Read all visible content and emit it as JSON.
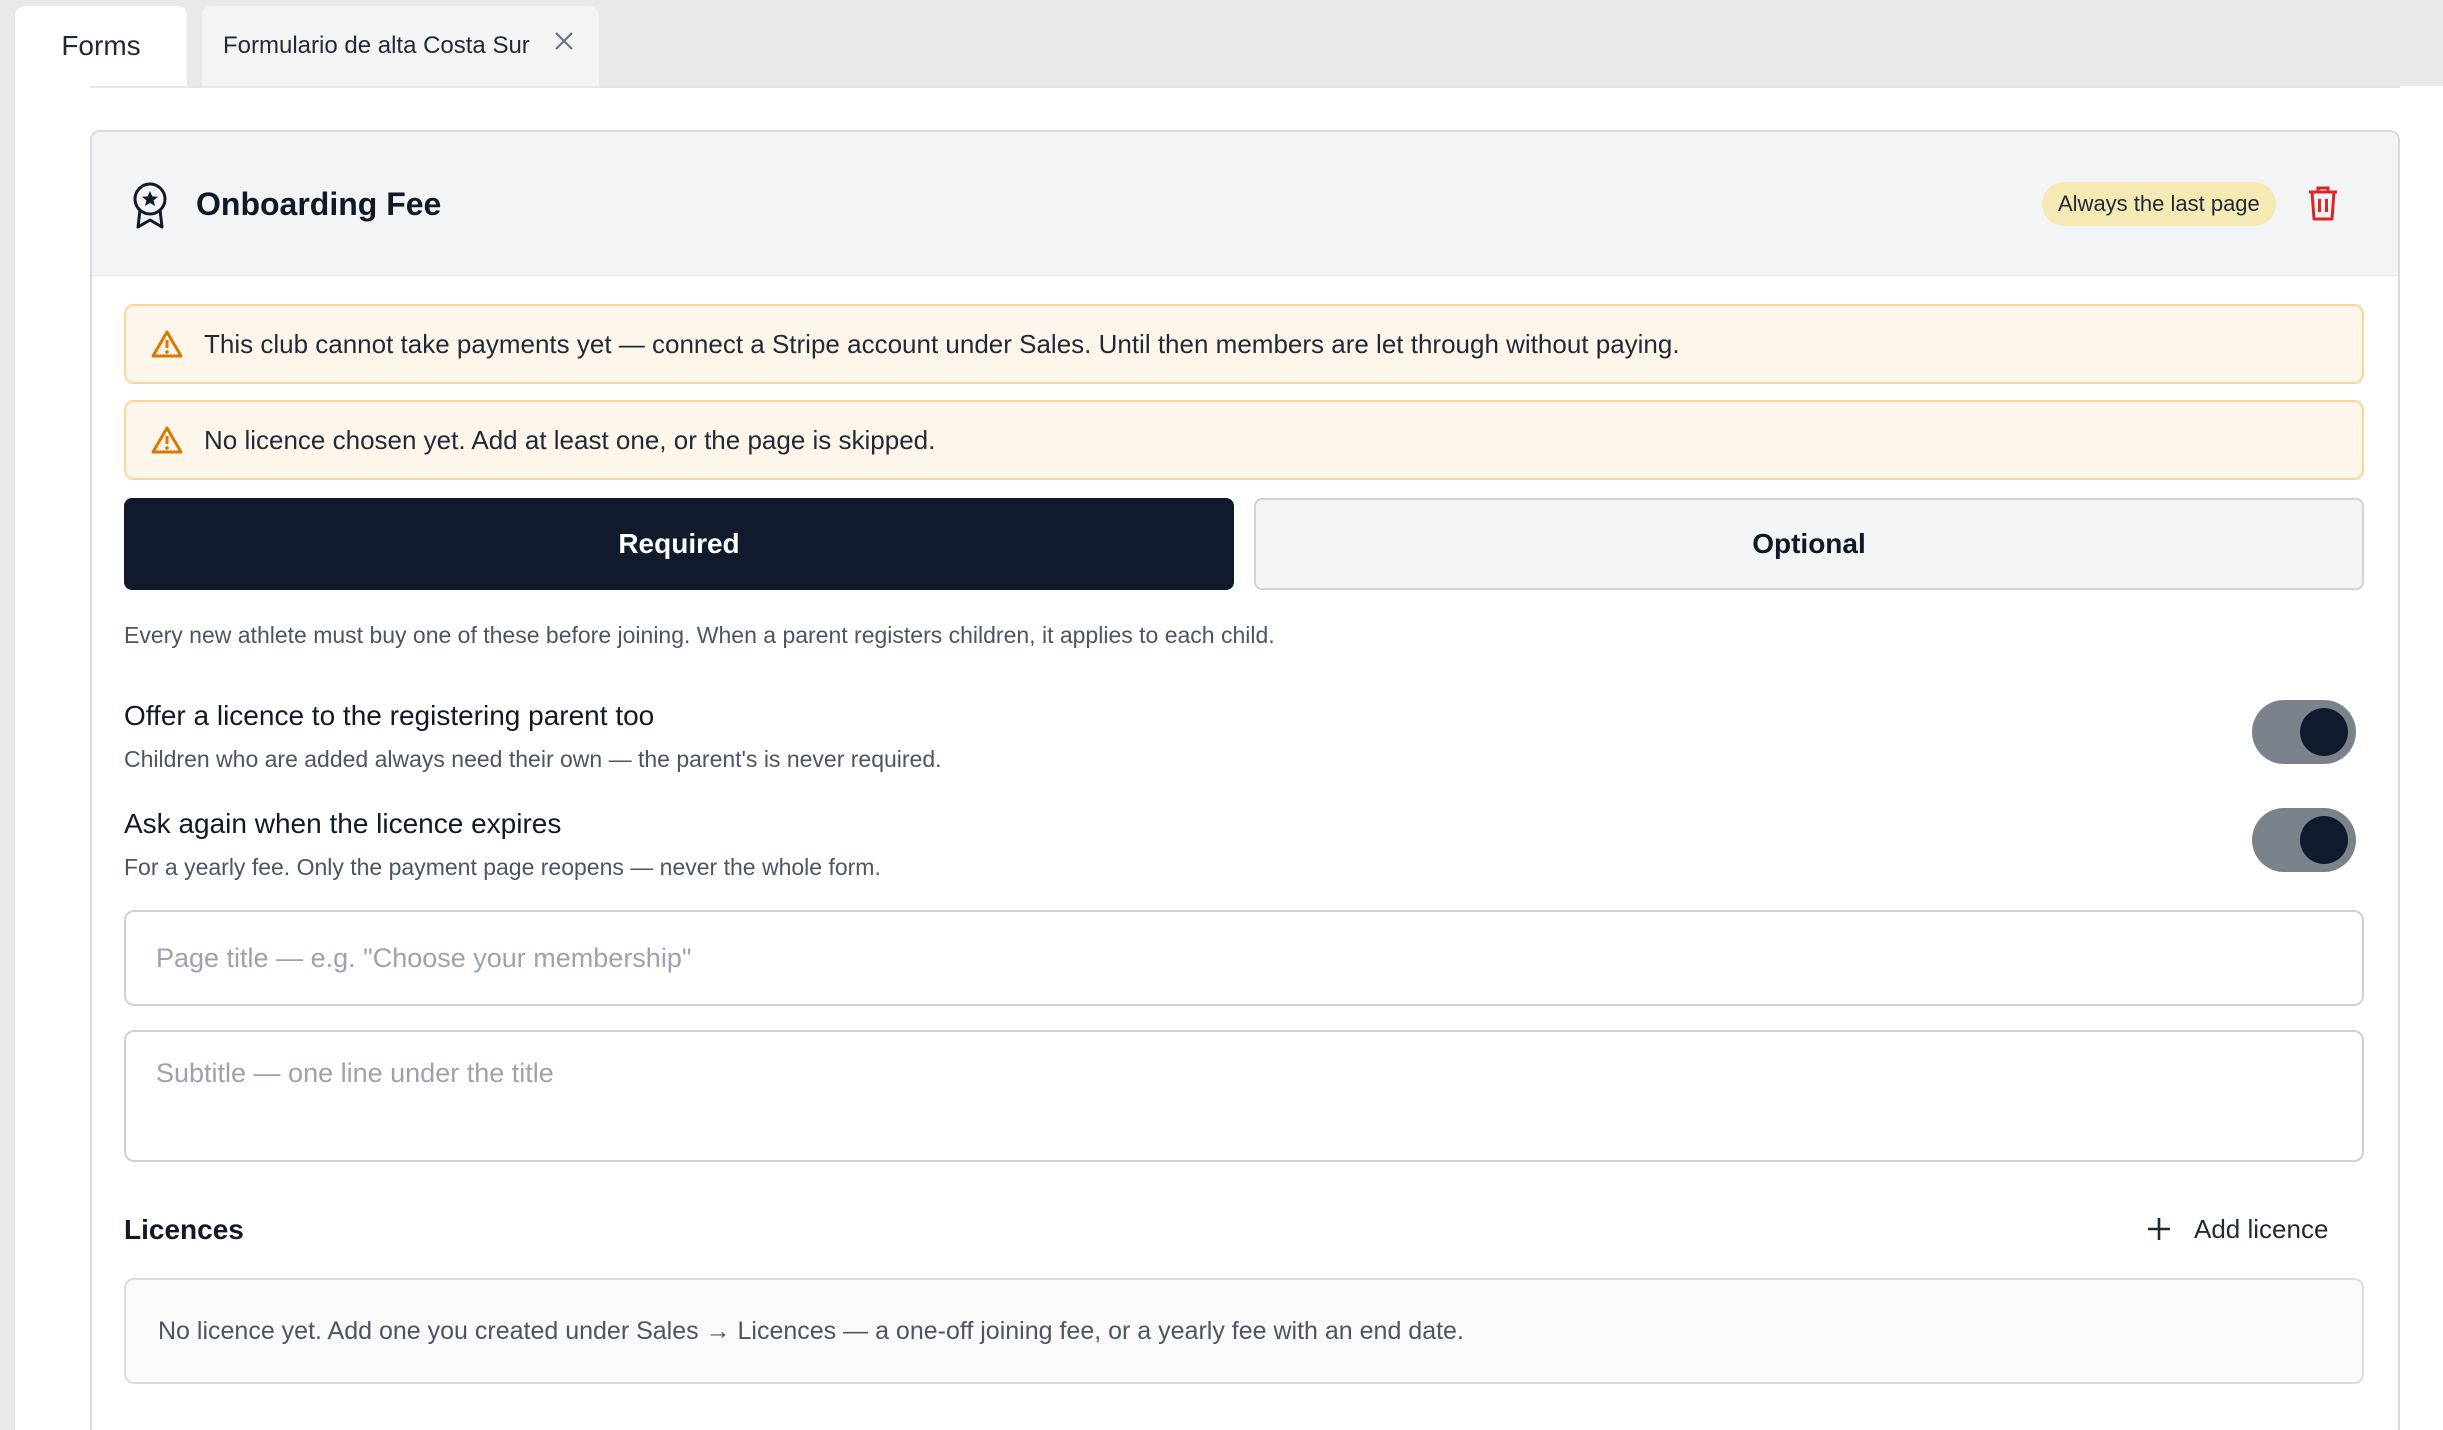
{
  "tabs": [
    {
      "label": "Forms"
    },
    {
      "label": "Formulario de alta Costa Sur"
    }
  ],
  "card": {
    "title": "Onboarding Fee",
    "badge": "Always the last page",
    "icons": {
      "header": "award-badge-icon",
      "delete": "trash-icon",
      "warning": "warning-triangle-icon",
      "add": "plus-icon",
      "close": "close-icon"
    }
  },
  "alerts": [
    {
      "text": "This club cannot take payments yet — connect a Stripe account under Sales. Until then members are let through without paying."
    },
    {
      "text": "No licence chosen yet. Add at least one, or the page is skipped."
    }
  ],
  "mode": {
    "required_label": "Required",
    "optional_label": "Optional",
    "selected": "Required",
    "help": "Every new athlete must buy one of these before joining. When a parent registers children, it applies to each child."
  },
  "toggles": [
    {
      "title": "Offer a licence to the registering parent too",
      "desc": "Children who are added always need their own — the parent's is never required.",
      "on": true
    },
    {
      "title": "Ask again when the licence expires",
      "desc": "For a yearly fee. Only the payment page reopens — never the whole form.",
      "on": true
    }
  ],
  "fields": {
    "title_placeholder": "Page title — e.g. \"Choose your membership\"",
    "subtitle_placeholder": "Subtitle — one line under the title"
  },
  "licences": {
    "heading": "Licences",
    "add_label": "Add licence",
    "empty_text": "No licence yet. Add one you created under Sales → Licences — a one-off joining fee, or a yearly fee with an end date."
  },
  "colors": {
    "primary": "#111a2d",
    "badge_bg": "#f5eab3",
    "alert_bg": "#fef6ea",
    "alert_border": "#f8d79a",
    "warning": "#d97706",
    "danger": "#dc2626"
  }
}
